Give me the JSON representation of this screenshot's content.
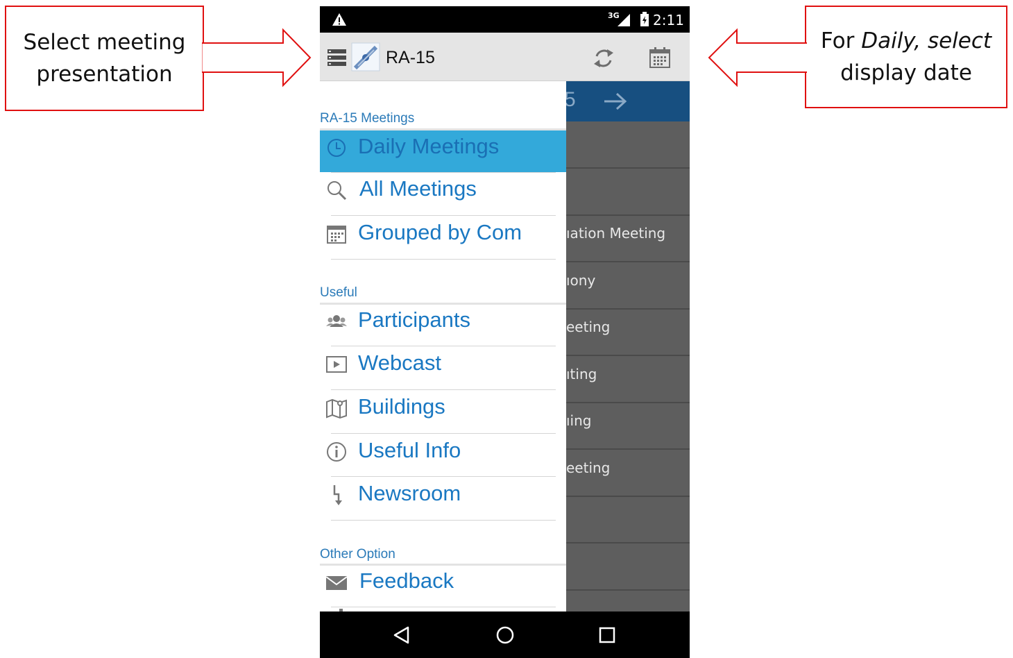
{
  "callouts": {
    "left": {
      "line1": "Select meeting",
      "line2": "presentation"
    },
    "right": {
      "prefix": "For ",
      "emphasis": "Daily, select",
      "line2": "display date"
    }
  },
  "status_bar": {
    "network": "3G",
    "time": "2:11"
  },
  "toolbar": {
    "title": "RA-15"
  },
  "background_list": {
    "rows": [
      "",
      "",
      "ıation Meeting",
      "ıony",
      "eeting",
      "ıting",
      "ıing",
      "eeting",
      "",
      ""
    ]
  },
  "drawer": {
    "sections": [
      {
        "title": "RA-15 Meetings",
        "items": [
          {
            "label": "Daily Meetings",
            "icon": "clock-icon",
            "active": true
          },
          {
            "label": "All Meetings",
            "icon": "search-icon"
          },
          {
            "label": "Grouped by Com",
            "icon": "calendar-icon"
          }
        ]
      },
      {
        "title": "Useful",
        "items": [
          {
            "label": "Participants",
            "icon": "people-icon"
          },
          {
            "label": "Webcast",
            "icon": "play-icon"
          },
          {
            "label": "Buildings",
            "icon": "map-icon"
          },
          {
            "label": "Useful Info",
            "icon": "info-icon"
          },
          {
            "label": "Newsroom",
            "icon": "newsroom-icon"
          }
        ]
      },
      {
        "title": "Other Option",
        "items": [
          {
            "label": "Feedback",
            "icon": "mail-icon"
          }
        ]
      }
    ]
  },
  "colors": {
    "callout_border": "#e01010",
    "drawer_text": "#1a78c2",
    "active_item_bg": "#33a9da",
    "content_header": "#174f80"
  }
}
